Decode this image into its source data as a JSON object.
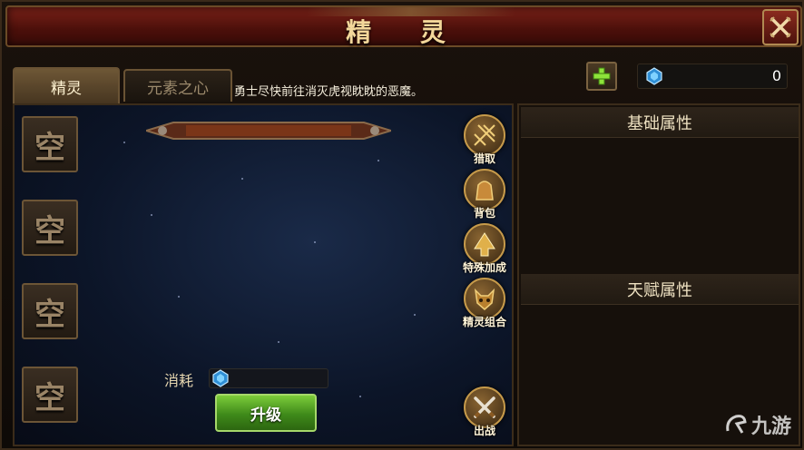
{
  "window": {
    "title": "精 灵"
  },
  "tabs": [
    {
      "label": "精灵",
      "active": true
    },
    {
      "label": "元素之心",
      "active": false
    }
  ],
  "notice": "勇士尽快前往消灭虎视眈眈的恶魔。",
  "currency": {
    "value": "0",
    "icon": "crystal-gem-icon"
  },
  "slots": [
    "空",
    "空",
    "空",
    "空"
  ],
  "side_buttons": [
    {
      "label": "猎取",
      "icon": "net-icon"
    },
    {
      "label": "背包",
      "icon": "bag-icon"
    },
    {
      "label": "特殊加成",
      "icon": "arrow-up-icon"
    },
    {
      "label": "精灵组合",
      "icon": "beast-head-icon"
    },
    {
      "label": "出战",
      "icon": "crossed-swords-icon"
    }
  ],
  "cost": {
    "label": "消耗",
    "value": ""
  },
  "upgrade_button": "升级",
  "right_panel": {
    "basic_header": "基础属性",
    "talent_header": "天赋属性"
  },
  "watermark": {
    "text": "九游"
  },
  "colors": {
    "title_red": "#7a2118",
    "gold_text": "#f3d79a",
    "upgrade_green": "#3f8a1a"
  }
}
